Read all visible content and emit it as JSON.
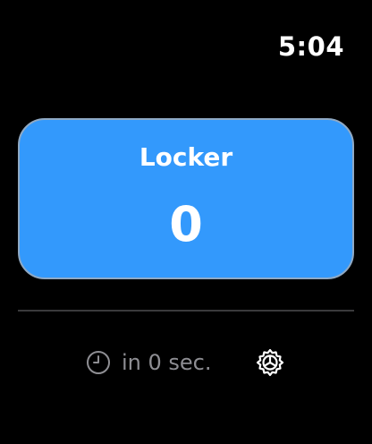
{
  "status_bar": {
    "time": "5:04"
  },
  "locker": {
    "title": "Locker",
    "count": "0"
  },
  "footer": {
    "timer_text": "in 0 sec.",
    "clock_icon": "clock-icon",
    "settings_icon": "gear-icon"
  },
  "colors": {
    "background": "#000000",
    "card": "#3399fc",
    "card_border": "#8fa9c4",
    "secondary_text": "#8e8e93",
    "divider": "#3a3a3c"
  }
}
